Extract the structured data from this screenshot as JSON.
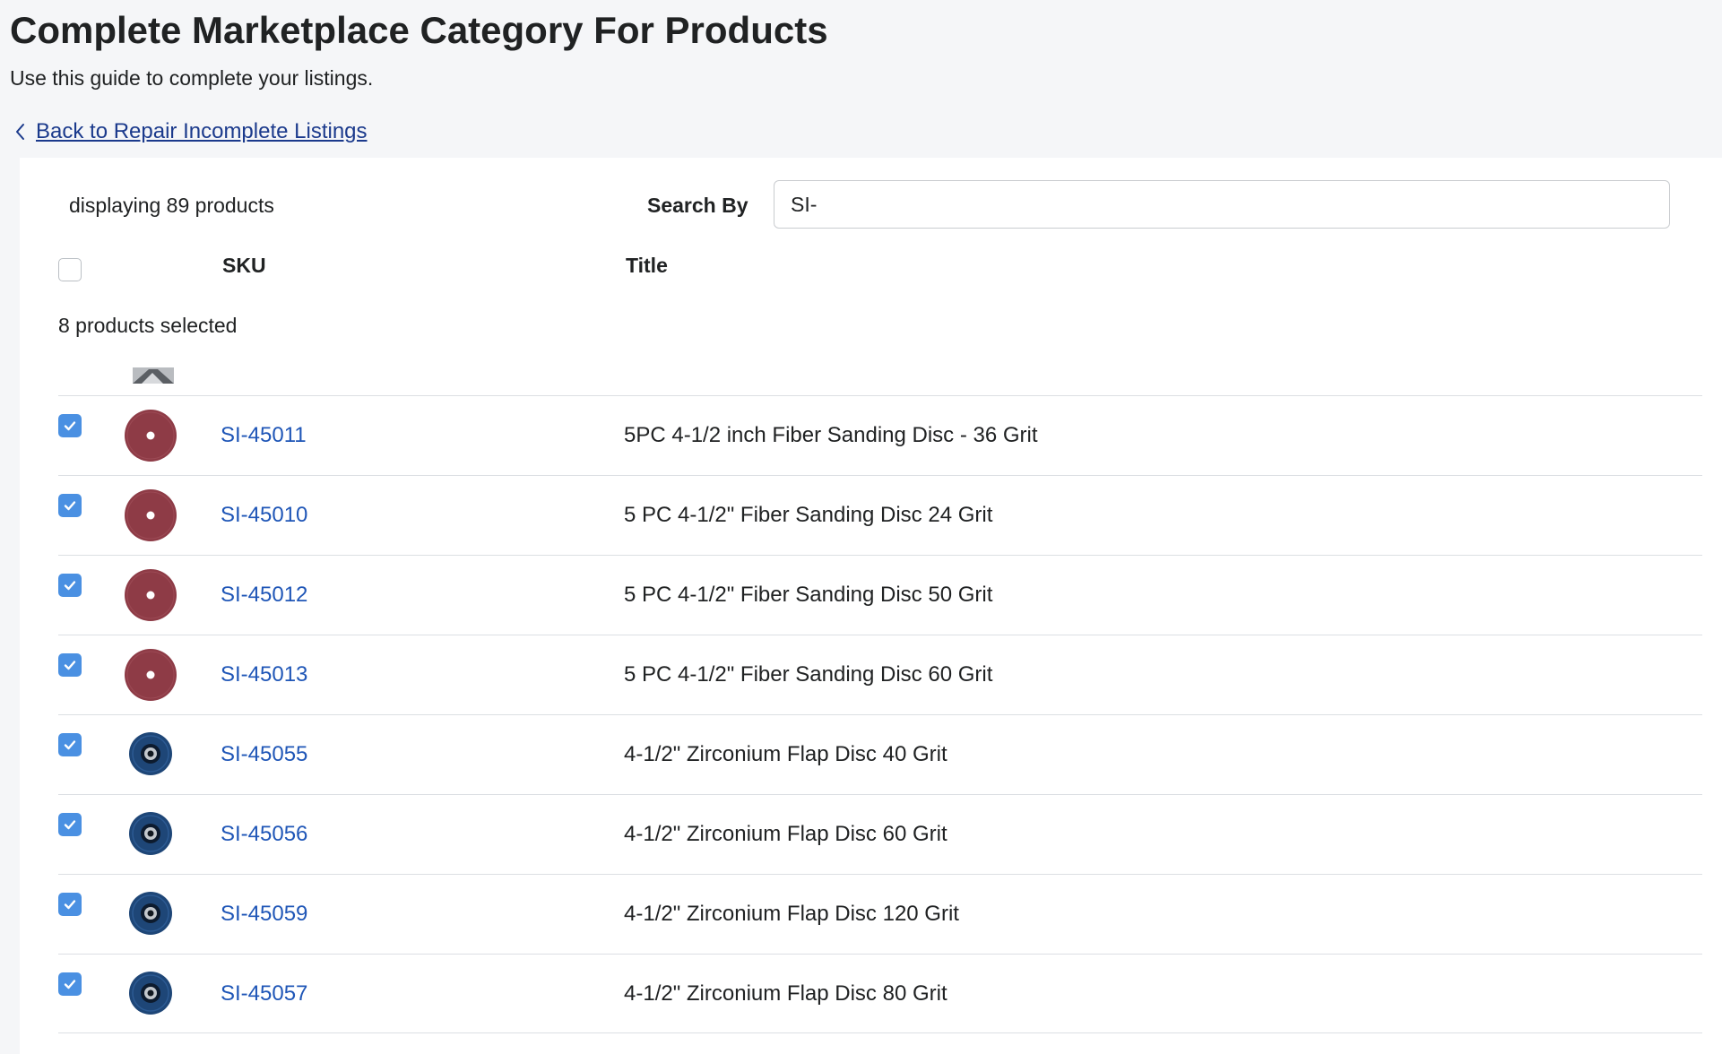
{
  "header": {
    "title": "Complete Marketplace Category For Products",
    "subtitle": "Use this guide to complete your listings.",
    "back_link": "Back to Repair Incomplete Listings"
  },
  "toolbar": {
    "count_text": "displaying 89 products",
    "search_label": "Search By",
    "search_value": "SI-"
  },
  "table": {
    "columns": {
      "sku": "SKU",
      "title": "Title"
    },
    "selected_text": "8 products selected",
    "rows": [
      {
        "sku": "SI-45011",
        "title": "5PC 4-1/2 inch Fiber Sanding Disc - 36 Grit",
        "checked": true,
        "thumb": "sanding-disc"
      },
      {
        "sku": "SI-45010",
        "title": "5 PC 4-1/2\" Fiber Sanding Disc 24 Grit",
        "checked": true,
        "thumb": "sanding-disc"
      },
      {
        "sku": "SI-45012",
        "title": "5 PC 4-1/2\" Fiber Sanding Disc 50 Grit",
        "checked": true,
        "thumb": "sanding-disc"
      },
      {
        "sku": "SI-45013",
        "title": "5 PC 4-1/2\" Fiber Sanding Disc 60 Grit",
        "checked": true,
        "thumb": "sanding-disc"
      },
      {
        "sku": "SI-45055",
        "title": "4-1/2\" Zirconium Flap Disc 40 Grit",
        "checked": true,
        "thumb": "flap-disc"
      },
      {
        "sku": "SI-45056",
        "title": "4-1/2\" Zirconium Flap Disc 60 Grit",
        "checked": true,
        "thumb": "flap-disc"
      },
      {
        "sku": "SI-45059",
        "title": "4-1/2\" Zirconium Flap Disc 120 Grit",
        "checked": true,
        "thumb": "flap-disc"
      },
      {
        "sku": "SI-45057",
        "title": "4-1/2\" Zirconium Flap Disc 80 Grit",
        "checked": true,
        "thumb": "flap-disc"
      }
    ]
  },
  "colors": {
    "link": "#1f56b7",
    "checkbox_checked": "#4a90e2",
    "sanding_disc": "#8e3b46",
    "flap_disc": "#1e4677"
  }
}
